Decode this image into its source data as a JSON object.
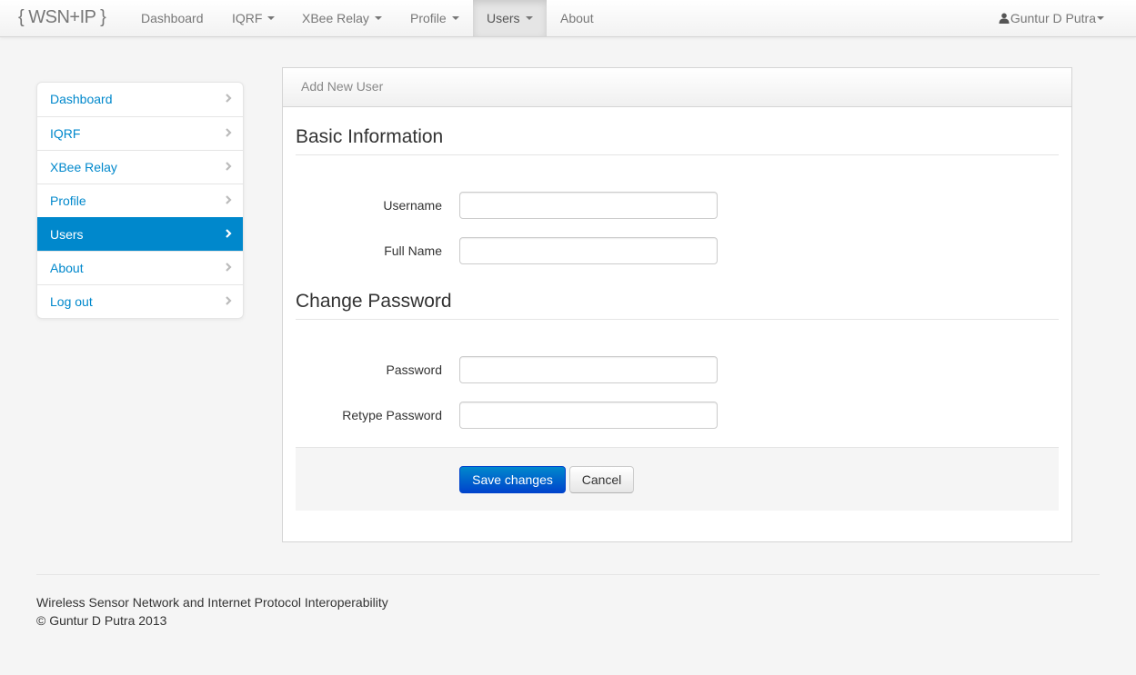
{
  "navbar": {
    "brand": "{ WSN+IP }",
    "items": [
      {
        "label": "Dashboard",
        "dropdown": false
      },
      {
        "label": "IQRF",
        "dropdown": true
      },
      {
        "label": "XBee Relay",
        "dropdown": true
      },
      {
        "label": "Profile",
        "dropdown": true
      },
      {
        "label": "Users",
        "dropdown": true,
        "active": true
      },
      {
        "label": "About",
        "dropdown": false
      }
    ],
    "user": "Guntur D Putra"
  },
  "sidebar": {
    "items": [
      {
        "label": "Dashboard"
      },
      {
        "label": "IQRF"
      },
      {
        "label": "XBee Relay"
      },
      {
        "label": "Profile"
      },
      {
        "label": "Users",
        "active": true
      },
      {
        "label": "About"
      },
      {
        "label": "Log out"
      }
    ]
  },
  "panel": {
    "title": "Add New User",
    "basic_section": "Basic Information",
    "username_label": "Username",
    "username_value": "",
    "fullname_label": "Full Name",
    "fullname_value": "",
    "password_section": "Change Password",
    "password_label": "Password",
    "password_value": "",
    "retype_label": "Retype Password",
    "retype_value": "",
    "save_label": "Save changes",
    "cancel_label": "Cancel"
  },
  "footer": {
    "line1": "Wireless Sensor Network and Internet Protocol Interoperability",
    "line2": "© Guntur D Putra 2013"
  },
  "colors": {
    "link": "#0088cc",
    "active_bg": "#0088cc",
    "primary_button": "#0055cc",
    "background": "#f5f5f5"
  }
}
